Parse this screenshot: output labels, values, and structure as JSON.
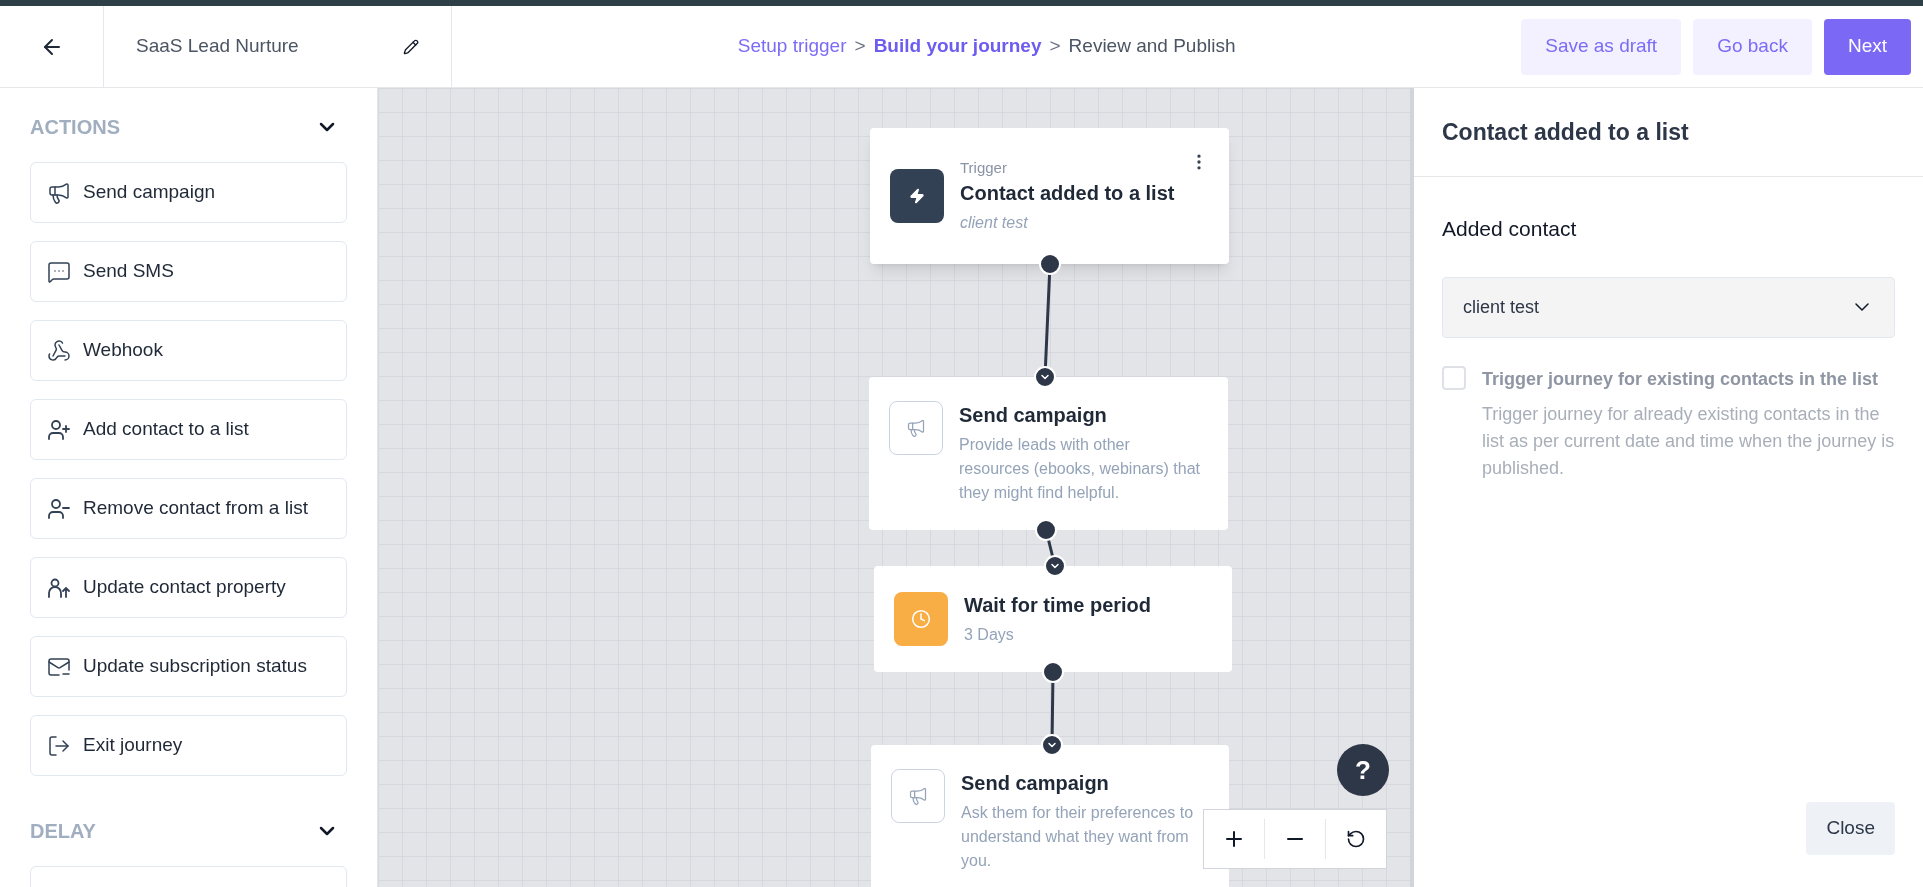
{
  "header": {
    "journey_name": "SaaS Lead Nurture",
    "steps": [
      {
        "label": "Setup trigger",
        "completed": true,
        "selected": false
      },
      {
        "label": "Build your journey",
        "completed": false,
        "selected": true
      },
      {
        "label": "Review and Publish",
        "completed": false,
        "selected": false
      }
    ],
    "separators": [
      ">",
      ">"
    ],
    "buttons": [
      {
        "label": "Save as draft",
        "kind": "secondary"
      },
      {
        "label": "Go back",
        "kind": "secondary"
      },
      {
        "label": "Next",
        "kind": "primary"
      }
    ]
  },
  "sidebar": {
    "sections": [
      {
        "title": "ACTIONS",
        "expanded": true,
        "items": [
          {
            "label": "Send campaign"
          },
          {
            "label": "Send SMS"
          },
          {
            "label": "Webhook"
          },
          {
            "label": "Add contact to a list"
          },
          {
            "label": "Remove contact from a list"
          },
          {
            "label": "Update contact property"
          },
          {
            "label": "Update subscription status"
          },
          {
            "label": "Exit journey"
          }
        ]
      },
      {
        "title": "DELAY",
        "expanded": true
      }
    ]
  },
  "canvas": {
    "nodes": [
      {
        "kind": "trigger",
        "label": "Trigger",
        "title": "Contact added to a list",
        "subtitle": "client test"
      },
      {
        "kind": "action",
        "title": "Send campaign",
        "subtitle": "Provide leads with other resources (ebooks, webinars) that they might find helpful."
      },
      {
        "kind": "delay",
        "title": "Wait for time period",
        "subtitle": "3 Days"
      },
      {
        "kind": "action",
        "title": "Send campaign",
        "subtitle": "Ask them for their preferences to understand what they want from you."
      }
    ],
    "help_label": "?"
  },
  "panel": {
    "title": "Contact added to a list",
    "field_label": "Added contact",
    "select_value": "client test",
    "checkbox": {
      "label": "Trigger journey for existing contacts in the list",
      "checked": false,
      "disabled": true,
      "description": "Trigger journey for already existing contacts in the list as per current date and time when the journey is published."
    },
    "close_label": "Close"
  }
}
